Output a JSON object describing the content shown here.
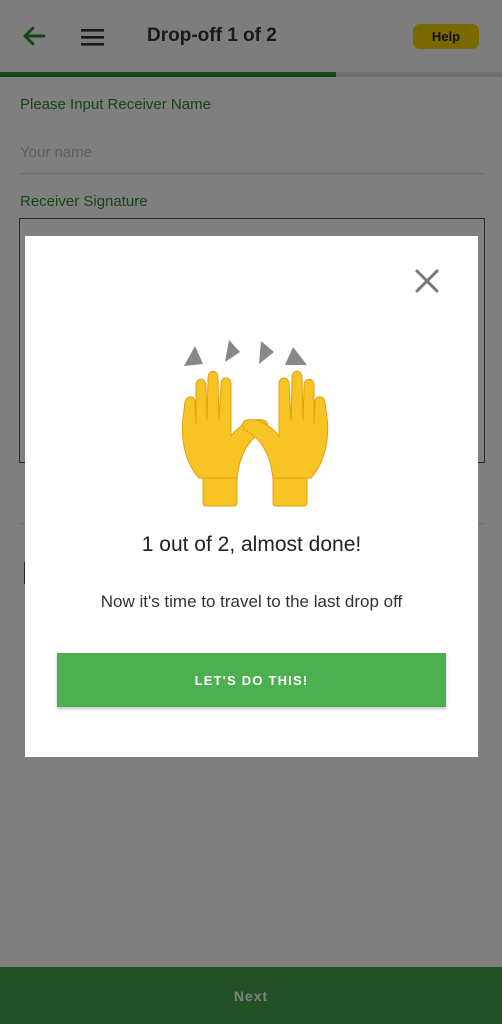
{
  "header": {
    "title": "Drop-off 1 of 2",
    "help_label": "Help",
    "progress_fraction": 0.67,
    "back_icon": "arrow-left-icon",
    "menu_icon": "hamburger-menu-icon"
  },
  "form": {
    "receiver_name_label": "Please Input Receiver Name",
    "receiver_name_placeholder": "Your name",
    "receiver_name_value": "",
    "signature_label": "Receiver Signature"
  },
  "footer": {
    "next_label": "Next"
  },
  "modal": {
    "close_icon": "close-icon",
    "emoji_icon": "raising-hands-emoji-icon",
    "heading": "1 out of 2, almost done!",
    "body": "Now it's time to travel to the last drop off",
    "cta_label": "LET'S DO THIS!"
  },
  "colors": {
    "brand_green": "#46a049",
    "progress_green": "#2e8b2e",
    "help_yellow": "#f2d300"
  }
}
